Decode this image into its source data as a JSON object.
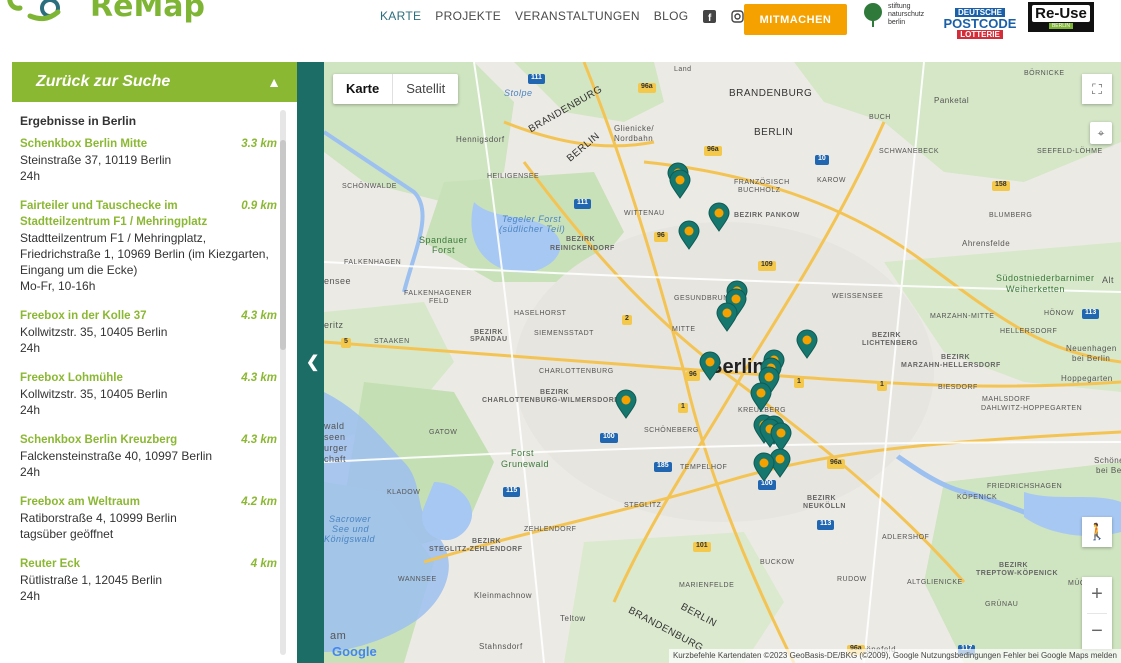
{
  "header": {
    "logo_text": "ReMap",
    "nav": [
      {
        "label": "KARTE",
        "active": true
      },
      {
        "label": "PROJEKTE",
        "active": false
      },
      {
        "label": "VERANSTALTUNGEN",
        "active": false
      },
      {
        "label": "BLOG",
        "active": false
      }
    ],
    "social_icons": [
      "facebook-icon",
      "instagram-icon"
    ],
    "cta_label": "MITMACHEN",
    "partners": {
      "stiftung": [
        "stiftung",
        "naturschutz",
        "berlin"
      ],
      "postcode": [
        "DEUTSCHE",
        "POSTCODE",
        "LOTTERIE"
      ],
      "reuse": [
        "Re-Use",
        "BERLIN"
      ]
    }
  },
  "sidebar": {
    "back_label": "Zurück zur Suche",
    "results_title": "Ergebnisse in Berlin",
    "results": [
      {
        "name": "Schenkbox Berlin Mitte",
        "distance": "3.3 km",
        "lines": [
          "Steinstraße 37, 10119 Berlin",
          "24h"
        ]
      },
      {
        "name": "Fairteiler und Tauschecke im Stadtteilzentrum F1 / Mehringplatz",
        "distance": "0.9 km",
        "lines": [
          "Stadtteilzentrum F1 / Mehringplatz,",
          "Friedrichstraße 1, 10969 Berlin (im Kiezgarten,",
          "Eingang um die Ecke)",
          "Mo-Fr, 10-16h"
        ]
      },
      {
        "name": "Freebox in der Kolle 37",
        "distance": "4.3 km",
        "lines": [
          "Kollwitzstr. 35, 10405 Berlin",
          "24h"
        ]
      },
      {
        "name": "Freebox Lohmühle",
        "distance": "4.3 km",
        "lines": [
          "Kollwitzstr. 35, 10405 Berlin",
          "24h"
        ]
      },
      {
        "name": "Schenkbox Berlin Kreuzberg",
        "distance": "4.3 km",
        "lines": [
          "Falckensteinstraße 40, 10997 Berlin",
          "24h"
        ]
      },
      {
        "name": "Freebox am Weltraum",
        "distance": "4.2 km",
        "lines": [
          "Ratiborstraße 4, 10999 Berlin",
          "tagsüber geöffnet"
        ]
      },
      {
        "name": "Reuter Eck",
        "distance": "4 km",
        "lines": [
          "Rütlistraße 1, 12045 Berlin",
          "24h"
        ]
      }
    ]
  },
  "map": {
    "maptype_options": [
      "Karte",
      "Satellit"
    ],
    "selected_maptype": "Karte",
    "city_label": "Berlin",
    "google_logo": "Google",
    "attribution": "Kurzbefehle   Kartendaten ©2023 GeoBasis-DE/BKG (©2009), Google   Nutzungsbedingungen   Fehler bei Google Maps melden",
    "labels": {
      "land": "Land",
      "brandenburg_1": "BRANDENBURG",
      "brandenburg_2": "BRANDENBURG",
      "brandenburg_3": "BRANDENBURG",
      "brandenburg_4": "BRANDENBURG",
      "berlin_rot": "BERLIN",
      "berlin_rot2": "BERLIN",
      "berlin_upper": "BERLIN",
      "stolpe": "Stolpe",
      "hennigsdorf": "Hennigsdorf",
      "glienicke": "Glienicke/",
      "nordbahn": "Nordbahn",
      "buch": "BUCH",
      "panketal": "Panketal",
      "bornicke": "BÖRNICKE",
      "schwanebeck": "SCHWANEBECK",
      "seefeld": "SEEFELD-LÖHME",
      "heiligensee": "HEILIGENSEE",
      "schoenwalde": "SCHÖNWALDE",
      "franzoesisch": "FRANZÖSISCH",
      "buchholz": "BUCHHOLZ",
      "karow": "KAROW",
      "wittenau": "WITTENAU",
      "bezirk_pankow": "BEZIRK PANKOW",
      "blumberg": "BLUMBERG",
      "tegeler_forst": "Tegeler Forst",
      "suedlicher_teil": "(südlicher Teil)",
      "spandauer_forst": "Spandauer",
      "forst_label": "Forst",
      "bezirk_reinickendorf": "BEZIRK",
      "reinickendorf": "REINICKENDORF",
      "ahrensfelde": "Ahrensfelde",
      "falkenhagen": "FALKENHAGEN",
      "suedost": "Südostniederbarnimer",
      "weiherketten": "Weiherketten",
      "falkenhagener_feld_1": "FALKENHAGENER",
      "falkenhagener_feld_2": "FELD",
      "gesundbrunnen": "GESUNDBRUNNEN",
      "weissensee": "WEISSENSEE",
      "haselhorst": "HASELHORST",
      "siemensstadt": "SIEMENSSTADT",
      "mitte": "MITTE",
      "marzahn_mitte": "MARZAHN-MITTE",
      "hoenow": "HÖNOW",
      "staaken": "STAAKEN",
      "bezirk_spandau": "BEZIRK",
      "spandau": "SPANDAU",
      "bezirk_lichtenberg": "BEZIRK",
      "lichtenberg": "LICHTENBERG",
      "hellersdorf": "HELLERSDORF",
      "marzahn_hellersdorf_1": "BEZIRK",
      "marzahn_hellersdorf_2": "MARZAHN-HELLERSDORF",
      "neuenhagen": "Neuenhagen",
      "bei_berlin": "bei Berlin",
      "hoppegarten": "Hoppegarten",
      "charlottenburg": "CHARLOTTENBURG",
      "bezirk_cw": "BEZIRK",
      "cw": "CHARLOTTENBURG-WILMERSDORF",
      "kreuzberg": "KREUZBERG",
      "biesdorf": "BIESDORF",
      "mahlsdorf": "MAHLSDORF",
      "dahlwitz": "DAHLWITZ-HOPPEGARTEN",
      "gatow": "GATOW",
      "schoeneberg": "SCHÖNEBERG",
      "forst_grunewald_1": "Forst",
      "forst_grunewald_2": "Grunewald",
      "tempelhof": "TEMPELHOF",
      "schoenefeld_bei": "Schöneich",
      "bei_ber": "bei Ber",
      "friedrichshagen": "FRIEDRICHSHAGEN",
      "kladow": "KLADOW",
      "steglitz": "STEGLITZ",
      "bezirk_neukoelln": "BEZIRK",
      "neukoelln": "NEUKÖLLN",
      "koepenick": "KÖPENICK",
      "sacrower": "Sacrower",
      "see_und": "See und",
      "koenigswald": "Königswald",
      "zehlendorf": "ZEHLENDORF",
      "steglitz_zehlendorf_1": "BEZIRK",
      "steglitz_zehlendorf_2": "STEGLITZ-ZEHLENDORF",
      "adlershof": "ADLERSHOF",
      "bezirk_tk_1": "BEZIRK",
      "bezirk_tk_2": "TREPTOW-KÖPENICK",
      "mueggelheim": "MÜGGELH",
      "wannsee": "WANNSEE",
      "buckow": "BUCKOW",
      "rudow": "RUDOW",
      "altglienicke": "ALTGLIENICKE",
      "marienfelde": "MARIENFELDE",
      "kleinmachnow": "Kleinmachnow",
      "gruenau": "GRÜNAU",
      "teltow": "Teltow",
      "stahnsdorf": "Stahnsdorf",
      "schoenefeld": "Schönefeld",
      "wald": "wald",
      "seen": "seen",
      "urger": "urger",
      "chaft": "chaft",
      "ensee": "ensee",
      "eritz": "eritz",
      "am": "am",
      "alt": "Alt"
    },
    "road_shields": [
      {
        "text": "111",
        "kind": "blue"
      },
      {
        "text": "96a",
        "kind": "yellow"
      },
      {
        "text": "96a",
        "kind": "yellow"
      },
      {
        "text": "10",
        "kind": "blue"
      },
      {
        "text": "109",
        "kind": "yellow"
      },
      {
        "text": "158",
        "kind": "yellow"
      },
      {
        "text": "111",
        "kind": "blue"
      },
      {
        "text": "96",
        "kind": "yellow"
      },
      {
        "text": "5",
        "kind": "yellow"
      },
      {
        "text": "2",
        "kind": "yellow"
      },
      {
        "text": "1",
        "kind": "yellow"
      },
      {
        "text": "1",
        "kind": "yellow"
      },
      {
        "text": "96",
        "kind": "yellow"
      },
      {
        "text": "100",
        "kind": "blue"
      },
      {
        "text": "185",
        "kind": "blue"
      },
      {
        "text": "100",
        "kind": "blue"
      },
      {
        "text": "113",
        "kind": "blue"
      },
      {
        "text": "115",
        "kind": "blue"
      },
      {
        "text": "101",
        "kind": "yellow"
      },
      {
        "text": "96a",
        "kind": "yellow"
      },
      {
        "text": "96a",
        "kind": "yellow"
      },
      {
        "text": "113",
        "kind": "blue"
      },
      {
        "text": "117",
        "kind": "blue"
      },
      {
        "text": "1",
        "kind": "yellow"
      }
    ],
    "markers": 20
  },
  "colors": {
    "brand_green": "#8bb832",
    "logo_green": "#7fb534",
    "teal": "#1b6d66",
    "marker_teal": "#15776e",
    "marker_orange": "#f5a100",
    "cta_orange": "#f5a100",
    "nav_active": "#2b6e7d"
  }
}
